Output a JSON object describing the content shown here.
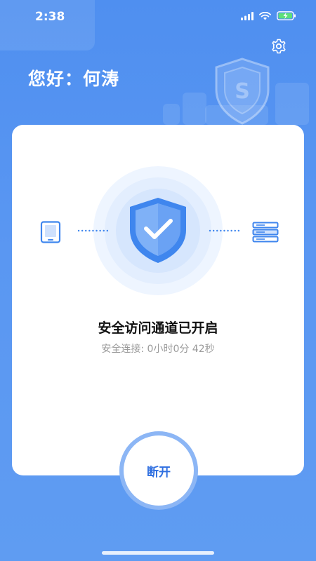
{
  "status_bar": {
    "time": "2:38",
    "icons": [
      "signal-icon",
      "wifi-icon",
      "battery-charging-icon"
    ]
  },
  "header": {
    "greeting": "您好：何涛"
  },
  "connection": {
    "title": "安全访问通道已开启",
    "duration_text": "安全连接: 0小时0分 42秒",
    "left_device_icon": "tablet-icon",
    "right_device_icon": "server-icon",
    "center_icon": "shield-check-icon"
  },
  "actions": {
    "disconnect_label": "断开"
  },
  "colors": {
    "primary": "#4f8ff0",
    "accent": "#2f6fe0",
    "card": "#ffffff"
  }
}
